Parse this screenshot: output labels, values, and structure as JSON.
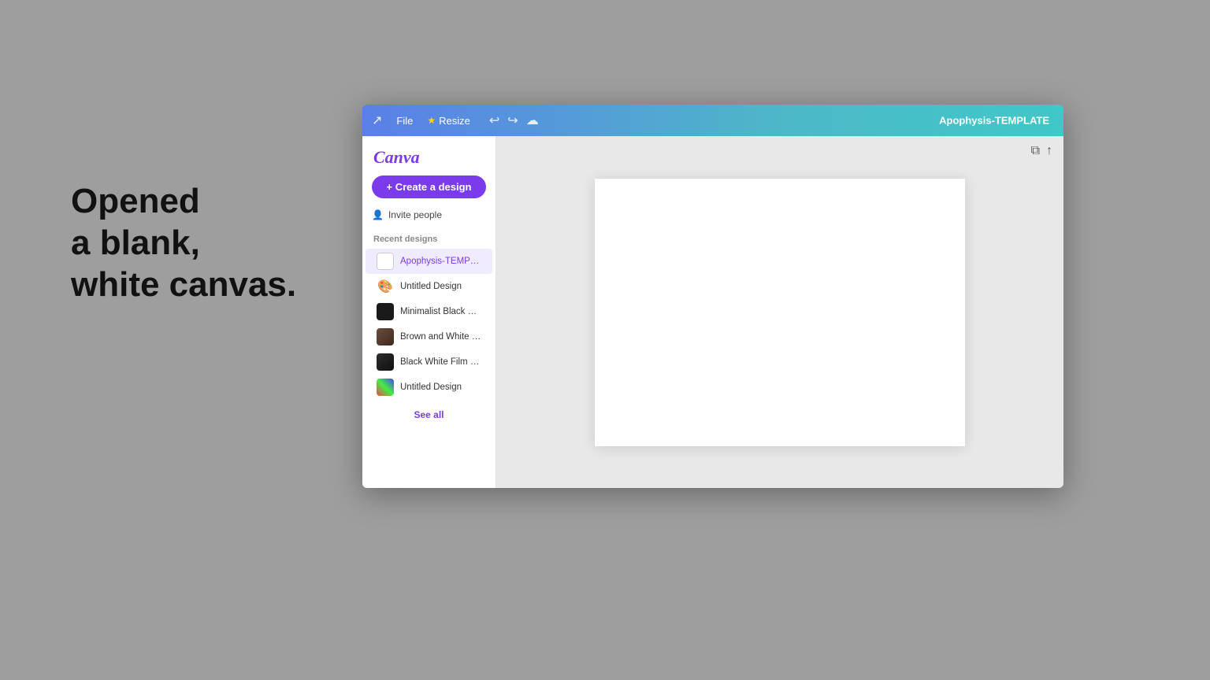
{
  "background": {
    "color": "#9e9e9e"
  },
  "annotation": {
    "line1": "Opened",
    "line2": "a blank,",
    "line3": "white canvas."
  },
  "header": {
    "file_label": "File",
    "resize_label": "Resize",
    "title": "Apophysis-TEMPLATE",
    "link_icon": "🔗",
    "undo_icon": "↩",
    "redo_icon": "↪",
    "cloud_icon": "☁"
  },
  "sidebar": {
    "logo": "Canva",
    "create_button_label": "+ Create a design",
    "invite_button_label": "Invite people",
    "recent_label": "Recent designs",
    "see_all_label": "See all",
    "items": [
      {
        "id": "apophysis",
        "name": "Apophysis-TEMPLATE",
        "thumb_type": "blank",
        "active": true
      },
      {
        "id": "untitled1",
        "name": "Untitled Design",
        "thumb_type": "icon",
        "active": false
      },
      {
        "id": "minimalist",
        "name": "Minimalist Black Whit...",
        "thumb_type": "dark",
        "active": false
      },
      {
        "id": "brown",
        "name": "Brown and White Pho...",
        "thumb_type": "brown",
        "active": false
      },
      {
        "id": "blackwhite",
        "name": "Black White Film Fram...",
        "thumb_type": "dark2",
        "active": false
      },
      {
        "id": "untitled2",
        "name": "Untitled Design",
        "thumb_type": "multi",
        "active": false
      }
    ]
  },
  "canvas": {
    "copy_icon": "⧉",
    "share_icon": "↑"
  }
}
